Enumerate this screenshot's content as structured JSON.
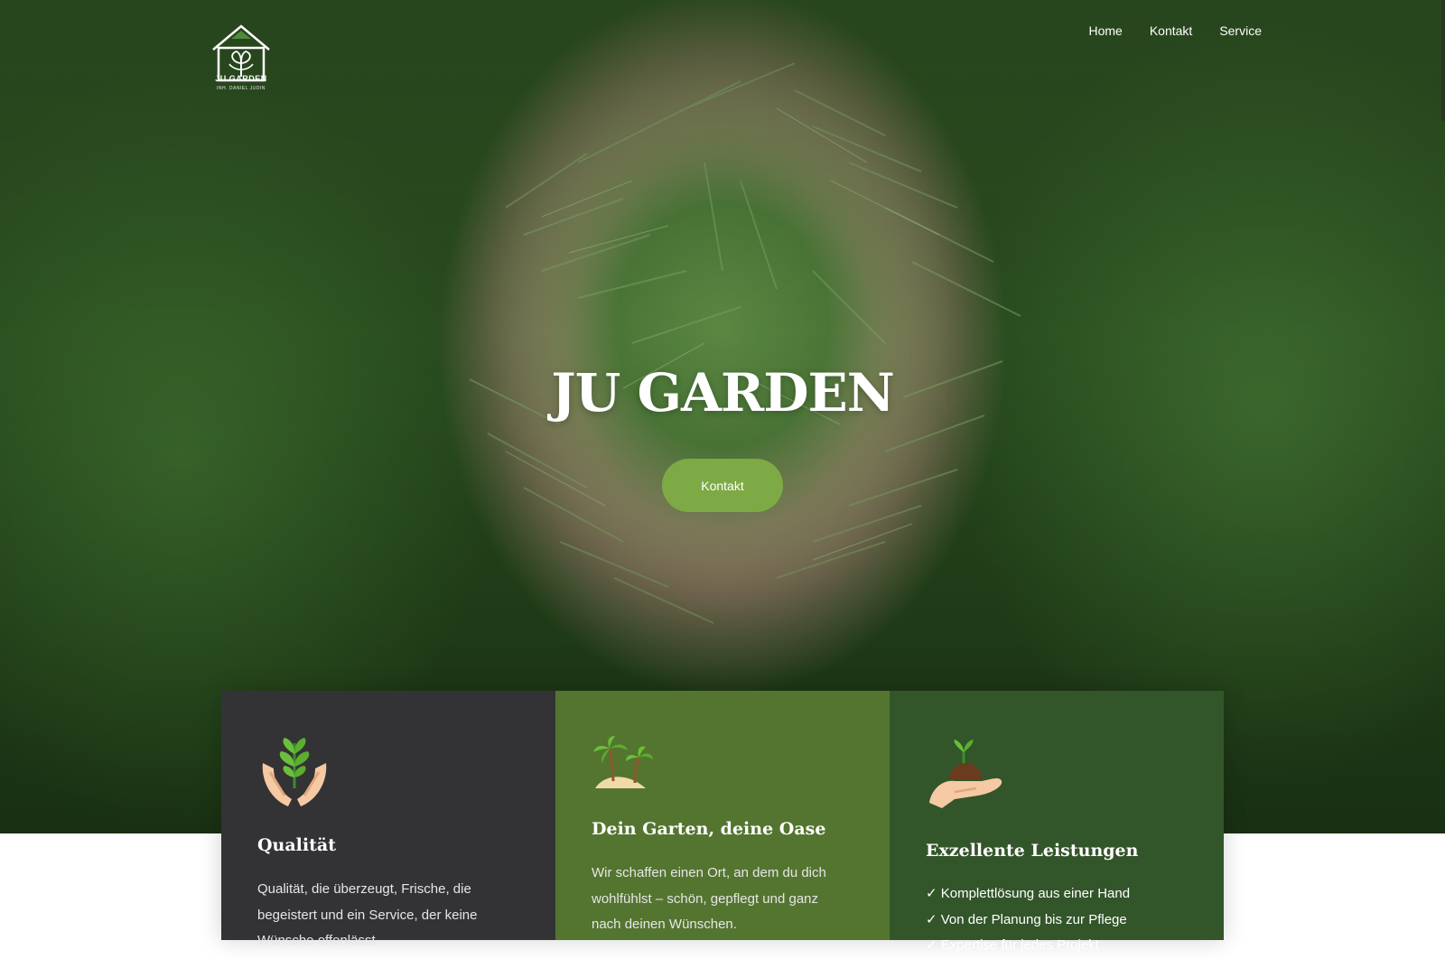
{
  "brand": {
    "logo_name": "JU GARDEN",
    "logo_sub": "INH. DANIEL JUDIN",
    "accent": "#7daa45"
  },
  "nav": {
    "items": [
      "Home",
      "Kontakt",
      "Service"
    ]
  },
  "hero": {
    "title": "JU GARDEN",
    "cta": "Kontakt"
  },
  "cards": [
    {
      "title": "Qualität",
      "text": "Qualität, die überzeugt, Frische, die begeistert und ein Service, der keine Wünsche offenlässt",
      "icon": "plant-hands-icon",
      "color": "#333336"
    },
    {
      "title": "Dein Garten, deine Oase",
      "text": "Wir schaffen einen Ort, an dem du dich wohlfühlst – schön, gepflegt und ganz nach deinen Wünschen.",
      "icon": "palm-island-icon",
      "color": "#547530"
    },
    {
      "title": "Exzellente Leistungen",
      "items": [
        "Komplettlösung aus einer Hand",
        "Von der Planung bis zur Pflege",
        "Expertise für jedes Projekt"
      ],
      "icon": "sprout-hand-icon",
      "color": "#33552a"
    }
  ]
}
